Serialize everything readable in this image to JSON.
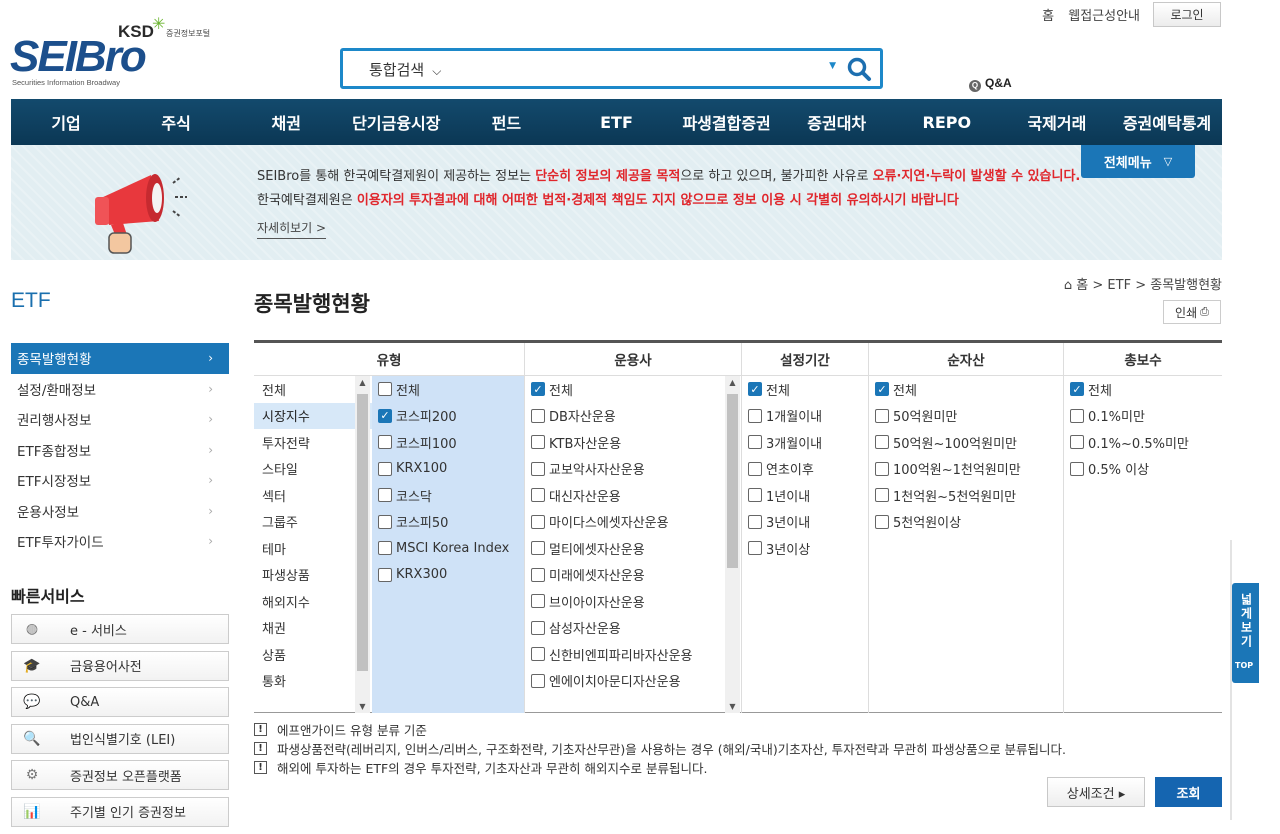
{
  "logo": {
    "brand_main": "SEIBro",
    "brand_ro": "",
    "ksd": "KSD",
    "ksd_sub": "증권정보포털",
    "sub": "Securities Information Broadway"
  },
  "top_links": {
    "home": "홈",
    "accessibility": "웹접근성안내",
    "login": "로그인"
  },
  "search": {
    "scope": "통합검색",
    "placeholder": ""
  },
  "qna_link": "Q&A",
  "gnb": [
    "기업",
    "주식",
    "채권",
    "단기금융시장",
    "펀드",
    "ETF",
    "파생결합증권",
    "증권대차",
    "REPO",
    "국제거래",
    "증권예탁통계"
  ],
  "banner": {
    "line1_a": "SEIBro를 통해 한국예탁결제원이 제공하는 정보는 ",
    "line1_b": "단순히 정보의 제공을 목적",
    "line1_c": "으로 하고 있으며, 불가피한 사유로 ",
    "line1_d": "오류·지연·누락이 발생할 수 있습니다.",
    "line2_a": "한국예탁결제원은 ",
    "line2_b": "이용자의 투자결과에 대해 어떠한 법적·경제적 책임도 지지 않으므로 정보 이용 시 각별히 유의하시기 바랍니다",
    "more": "자세히보기  >",
    "allmenu": "전체메뉴"
  },
  "lnb": {
    "title": "ETF",
    "items": [
      "종목발행현황",
      "설정/환매정보",
      "권리행사정보",
      "ETF종합정보",
      "ETF시장정보",
      "운용사정보",
      "ETF투자가이드"
    ],
    "active_index": 0
  },
  "quick": {
    "title": "빠른서비스",
    "items": [
      {
        "label": "e - 서비스",
        "icon": "globe-icon"
      },
      {
        "label": "금융용어사전",
        "icon": "graduation-cap-icon"
      },
      {
        "label": "Q&A",
        "icon": "chat-icon"
      },
      {
        "label": "법인식별기호 (LEI)",
        "icon": "document-search-icon"
      },
      {
        "label": "증권정보 오픈플랫폼",
        "icon": "gear-api-icon"
      },
      {
        "label": "주기별 인기 증권정보",
        "icon": "bar-chart-icon"
      }
    ]
  },
  "page": {
    "title": "종목발행현황",
    "breadcrumb": [
      "홈",
      "ETF",
      "종목발행현황"
    ],
    "print": "인쇄"
  },
  "filter": {
    "headers": {
      "type": "유형",
      "manager": "운용사",
      "period": "설정기간",
      "net_assets": "순자산",
      "fee": "총보수"
    },
    "type_categories": [
      "전체",
      "시장지수",
      "투자전략",
      "스타일",
      "섹터",
      "그룹주",
      "테마",
      "파생상품",
      "해외지수",
      "채권",
      "상품",
      "통화"
    ],
    "type_selected_index": 1,
    "type_sub": [
      {
        "label": "전체",
        "checked": false
      },
      {
        "label": "코스피200",
        "checked": true
      },
      {
        "label": "코스피100",
        "checked": false
      },
      {
        "label": "KRX100",
        "checked": false
      },
      {
        "label": "코스닥",
        "checked": false
      },
      {
        "label": "코스피50",
        "checked": false
      },
      {
        "label": "MSCI Korea Index",
        "checked": false
      },
      {
        "label": "KRX300",
        "checked": false
      }
    ],
    "managers": [
      {
        "label": "전체",
        "checked": true
      },
      {
        "label": "DB자산운용",
        "checked": false
      },
      {
        "label": "KTB자산운용",
        "checked": false
      },
      {
        "label": "교보악사자산운용",
        "checked": false
      },
      {
        "label": "대신자산운용",
        "checked": false
      },
      {
        "label": "마이다스에셋자산운용",
        "checked": false
      },
      {
        "label": "멀티에셋자산운용",
        "checked": false
      },
      {
        "label": "미래에셋자산운용",
        "checked": false
      },
      {
        "label": "브이아이자산운용",
        "checked": false
      },
      {
        "label": "삼성자산운용",
        "checked": false
      },
      {
        "label": "신한비엔피파리바자산운용",
        "checked": false
      },
      {
        "label": "엔에이치아문디자산운용",
        "checked": false
      }
    ],
    "periods": [
      {
        "label": "전체",
        "checked": true
      },
      {
        "label": "1개월이내",
        "checked": false
      },
      {
        "label": "3개월이내",
        "checked": false
      },
      {
        "label": "연초이후",
        "checked": false
      },
      {
        "label": "1년이내",
        "checked": false
      },
      {
        "label": "3년이내",
        "checked": false
      },
      {
        "label": "3년이상",
        "checked": false
      }
    ],
    "net_assets": [
      {
        "label": "전체",
        "checked": true
      },
      {
        "label": "50억원미만",
        "checked": false
      },
      {
        "label": "50억원~100억원미만",
        "checked": false
      },
      {
        "label": "100억원~1천억원미만",
        "checked": false
      },
      {
        "label": "1천억원~5천억원미만",
        "checked": false
      },
      {
        "label": "5천억원이상",
        "checked": false
      }
    ],
    "fees": [
      {
        "label": "전체",
        "checked": true
      },
      {
        "label": "0.1%미만",
        "checked": false
      },
      {
        "label": "0.1%~0.5%미만",
        "checked": false
      },
      {
        "label": "0.5% 이상",
        "checked": false
      }
    ]
  },
  "notes": [
    "에프앤가이드 유형 분류 기준",
    "파생상품전략(레버리지, 인버스/리버스, 구조화전략, 기초자산무관)을 사용하는 경우 (해외/국내)기초자산, 투자전략과 무관히 파생상품으로 분류됩니다.",
    "해외에 투자하는 ETF의 경우 투자전략, 기초자산과 무관히 해외지수로 분류됩니다."
  ],
  "buttons": {
    "detail": "상세조건  ▸",
    "search": "조회"
  },
  "side_tab": {
    "wide": "넓게보기",
    "top": "TOP"
  },
  "colors": {
    "primary": "#1b76b7",
    "nav_bg": "#0b3754",
    "alert_red": "#e0262c",
    "selected_bg": "#cfe2f7"
  }
}
